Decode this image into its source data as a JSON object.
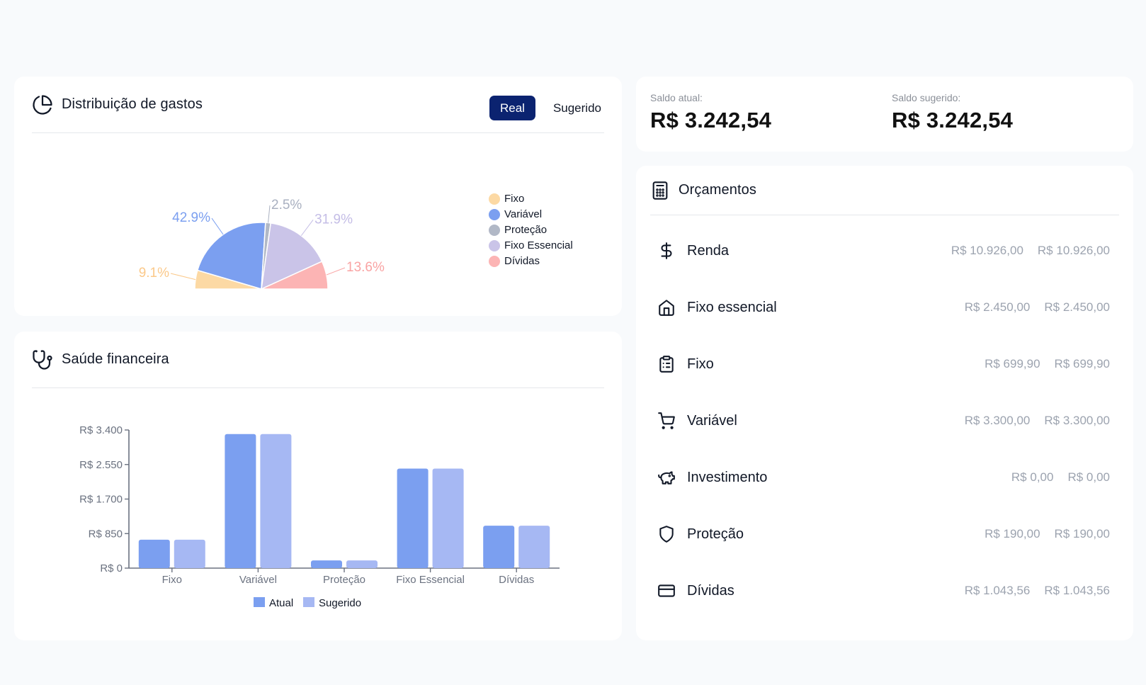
{
  "colors": {
    "fixo": "#fcd9a4",
    "variavel": "#7b9ff0",
    "protecao": "#b1b8c6",
    "fixo_essencial": "#cac4e8",
    "dividas": "#fcb4b4",
    "bar_atual": "#7b9ff0",
    "bar_sugerido": "#a6b8f3",
    "toggle_active": "#0b2370"
  },
  "distribution": {
    "title": "Distribuição de gastos",
    "icon": "pie-chart-icon",
    "toggle": {
      "real_label": "Real",
      "suggested_label": "Sugerido"
    },
    "legend": [
      "Fixo",
      "Variável",
      "Proteção",
      "Fixo Essencial",
      "Dívidas"
    ]
  },
  "health": {
    "title": "Saúde financeira",
    "icon": "stethoscope-icon"
  },
  "balances": {
    "current_label": "Saldo atual:",
    "current_value": "R$ 3.242,54",
    "suggested_label": "Saldo sugerido:",
    "suggested_value": "R$ 3.242,54"
  },
  "budgets": {
    "title": "Orçamentos",
    "icon": "calculator-icon",
    "items": [
      {
        "name": "Renda",
        "icon": "dollar-icon",
        "real": "R$ 10.926,00",
        "suggested": "R$ 10.926,00"
      },
      {
        "name": "Fixo essencial",
        "icon": "home-icon",
        "real": "R$ 2.450,00",
        "suggested": "R$ 2.450,00"
      },
      {
        "name": "Fixo",
        "icon": "clipboard-icon",
        "real": "R$ 699,90",
        "suggested": "R$ 699,90"
      },
      {
        "name": "Variável",
        "icon": "cart-icon",
        "real": "R$ 3.300,00",
        "suggested": "R$ 3.300,00"
      },
      {
        "name": "Investimento",
        "icon": "piggy-bank-icon",
        "real": "R$ 0,00",
        "suggested": "R$ 0,00"
      },
      {
        "name": "Proteção",
        "icon": "shield-icon",
        "real": "R$ 190,00",
        "suggested": "R$ 190,00"
      },
      {
        "name": "Dívidas",
        "icon": "credit-card-icon",
        "real": "R$ 1.043,56",
        "suggested": "R$ 1.043,56"
      }
    ]
  },
  "chart_data": [
    {
      "type": "pie",
      "subtype": "semicircle",
      "labels": [
        "Fixo",
        "Variável",
        "Proteção",
        "Fixo Essencial",
        "Dívidas"
      ],
      "values": [
        9.1,
        42.9,
        2.5,
        31.9,
        13.6
      ],
      "value_labels": [
        "9.1%",
        "42.9%",
        "2.5%",
        "31.9%",
        "13.6%"
      ],
      "legend_position": "right"
    },
    {
      "type": "bar",
      "categories": [
        "Fixo",
        "Variável",
        "Proteção",
        "Fixo Essencial",
        "Dívidas"
      ],
      "series": [
        {
          "name": "Atual",
          "values": [
            699.9,
            3300,
            190,
            2450,
            1043.56
          ]
        },
        {
          "name": "Sugerido",
          "values": [
            699.9,
            3300,
            190,
            2450,
            1043.56
          ]
        }
      ],
      "yticks": [
        0,
        850,
        1700,
        2550,
        3400
      ],
      "ytick_labels": [
        "R$ 0",
        "R$ 850",
        "R$ 1.700",
        "R$ 2.550",
        "R$ 3.400"
      ],
      "ylim": [
        0,
        3400
      ],
      "grid": false,
      "legend_position": "bottom"
    }
  ]
}
